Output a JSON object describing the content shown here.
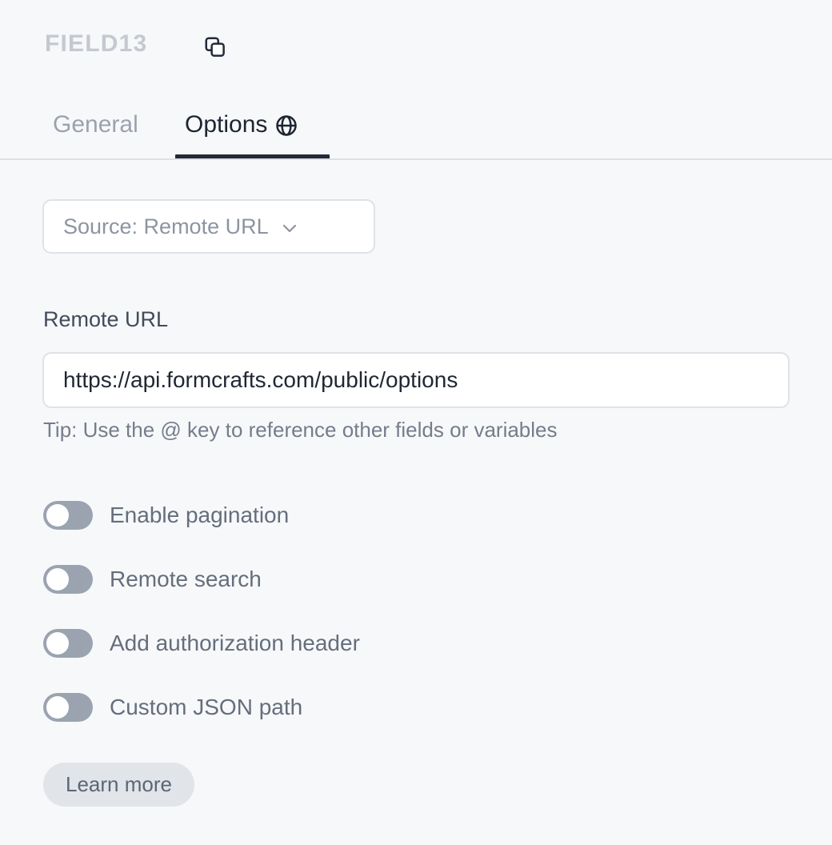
{
  "header": {
    "field_title": "FIELD13",
    "copy_icon": "copy-icon"
  },
  "tabs": [
    {
      "label": "General",
      "active": false,
      "icon": ""
    },
    {
      "label": "Options",
      "active": true,
      "icon": "globe-icon"
    }
  ],
  "options_panel": {
    "source_select": {
      "label": "Source: Remote URL",
      "chevron_icon": "chevron-down-icon"
    },
    "remote_url": {
      "label": "Remote URL",
      "value": "https://api.formcrafts.com/public/options",
      "placeholder": "https://",
      "tip": "Tip: Use the @ key to reference other fields or variables"
    },
    "toggles": [
      {
        "label": "Enable pagination",
        "on": false
      },
      {
        "label": "Remote search",
        "on": false
      },
      {
        "label": "Add authorization header",
        "on": false
      },
      {
        "label": "Custom JSON path",
        "on": false
      }
    ],
    "learn_more_label": "Learn more"
  },
  "colors": {
    "background": "#f7f8fa",
    "title_gray": "#c4c9d1",
    "tab_active": "#1e2532",
    "tab_inactive": "#9ba2ae",
    "underline": "#222a38",
    "border": "#dfe2e7",
    "toggle_off": "#9ba3b0",
    "pill_bg": "#e1e4e9",
    "text_gray": "#656e7c"
  }
}
